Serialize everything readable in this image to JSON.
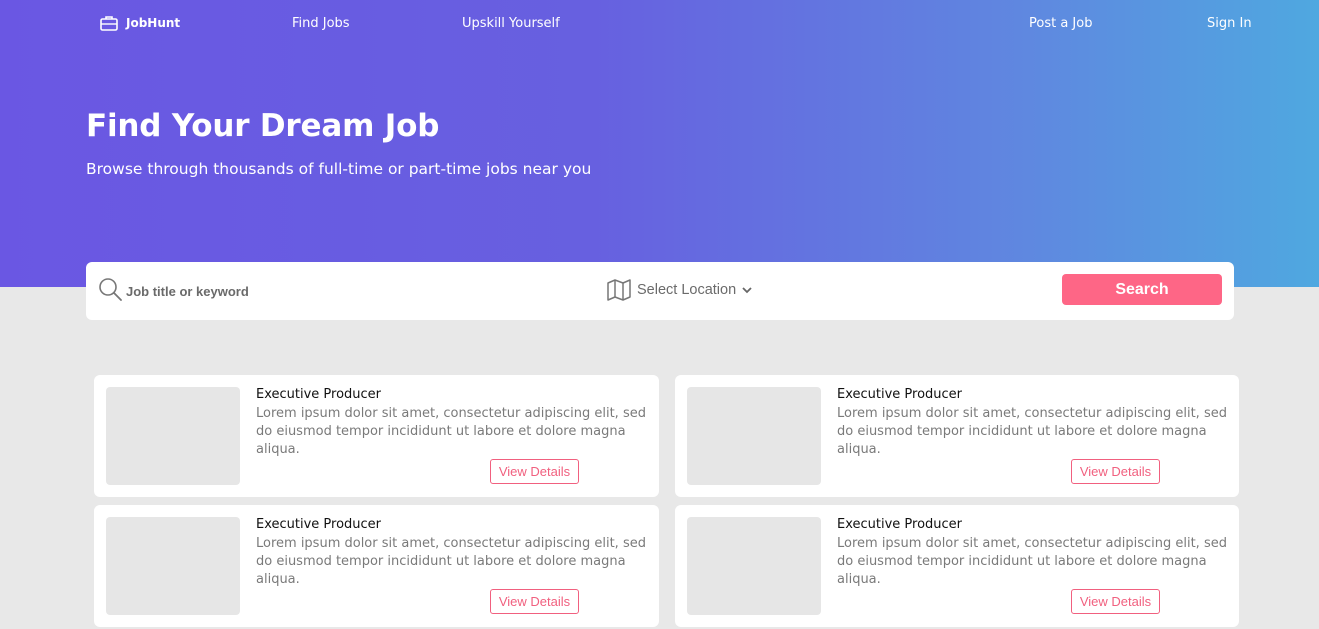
{
  "header": {
    "brand": "JobHunt",
    "nav_left": [
      "Find Jobs",
      "Upskill Yourself"
    ],
    "nav_right": [
      "Post a Job",
      "Sign In"
    ]
  },
  "hero": {
    "title": "Find Your Dream Job",
    "subtitle": "Browse through thousands of full-time or part-time jobs near you"
  },
  "search": {
    "placeholder": "Job title or keyword",
    "location_label": "Select Location",
    "button_label": "Search"
  },
  "jobs": [
    {
      "title": "Executive Producer",
      "description": "Lorem ipsum dolor sit amet, consectetur adipiscing elit, sed do eiusmod tempor incididunt ut labore et dolore magna aliqua.",
      "button": "View Details"
    },
    {
      "title": "Executive Producer",
      "description": "Lorem ipsum dolor sit amet, consectetur adipiscing elit, sed do eiusmod tempor incididunt ut labore et dolore magna aliqua.",
      "button": "View Details"
    },
    {
      "title": "Executive Producer",
      "description": "Lorem ipsum dolor sit amet, consectetur adipiscing elit, sed do eiusmod tempor incididunt ut labore et dolore magna aliqua.",
      "button": "View Details"
    },
    {
      "title": "Executive Producer",
      "description": "Lorem ipsum dolor sit amet, consectetur adipiscing elit, sed do eiusmod tempor incididunt ut labore et dolore magna aliqua.",
      "button": "View Details"
    }
  ],
  "icons": {
    "brand": "briefcase-icon",
    "search": "search-icon",
    "location": "map-icon",
    "dropdown": "chevron-down-icon"
  },
  "colors": {
    "gradient_start": "#6a57e3",
    "gradient_end": "#4fa8e0",
    "accent": "#fe6686",
    "page_background": "#e8e8e8"
  }
}
